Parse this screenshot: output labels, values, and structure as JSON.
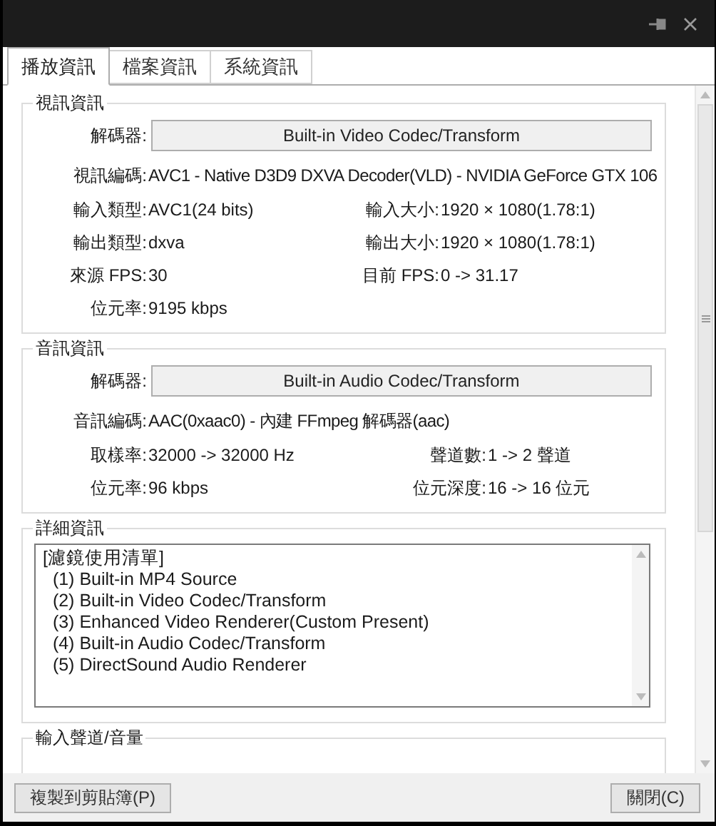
{
  "tabs": [
    {
      "label": "播放資訊",
      "selected": true
    },
    {
      "label": "檔案資訊",
      "selected": false
    },
    {
      "label": "系統資訊",
      "selected": false
    }
  ],
  "video_info": {
    "title": "視訊資訊",
    "decoder": {
      "label": "解碼器:",
      "value": "Built-in Video Codec/Transform"
    },
    "codec": {
      "label": "視訊編碼:",
      "value": "AVC1 - Native D3D9 DXVA Decoder(VLD) - NVIDIA GeForce GTX 106"
    },
    "rows": [
      [
        {
          "label": "輸入類型:",
          "value": "AVC1(24 bits)"
        },
        {
          "label": "輸入大小:",
          "value": "1920 × 1080(1.78:1)"
        }
      ],
      [
        {
          "label": "輸出類型:",
          "value": "dxva"
        },
        {
          "label": "輸出大小:",
          "value": "1920 × 1080(1.78:1)"
        }
      ],
      [
        {
          "label": "來源 FPS:",
          "value": "30"
        },
        {
          "label": "目前 FPS:",
          "value": "0 -> 31.17"
        }
      ],
      [
        {
          "label": "位元率:",
          "value": "9195 kbps"
        }
      ]
    ]
  },
  "audio_info": {
    "title": "音訊資訊",
    "decoder": {
      "label": "解碼器:",
      "value": "Built-in Audio Codec/Transform"
    },
    "codec": {
      "label": "音訊編碼:",
      "value": "AAC(0xaac0) - 內建 FFmpeg 解碼器(aac)"
    },
    "rows": [
      [
        {
          "label": "取樣率:",
          "value": "32000 -> 32000 Hz"
        },
        {
          "label": "聲道數:",
          "value": "1 -> 2 聲道"
        }
      ],
      [
        {
          "label": "位元率:",
          "value": "96 kbps"
        },
        {
          "label": "位元深度:",
          "value": "16 -> 16 位元"
        }
      ]
    ]
  },
  "details": {
    "title": "詳細資訊",
    "lines": [
      "[濾鏡使用清單]",
      "  (1) Built-in MP4 Source",
      "  (2) Built-in Video Codec/Transform",
      "  (3) Enhanced Video Renderer(Custom Present)",
      "  (4) Built-in Audio Codec/Transform",
      "  (5) DirectSound Audio Renderer"
    ]
  },
  "input_channels": {
    "title": "輸入聲道/音量"
  },
  "buttons": {
    "copy": "複製到剪貼簿(P)",
    "close": "關閉(C)"
  }
}
